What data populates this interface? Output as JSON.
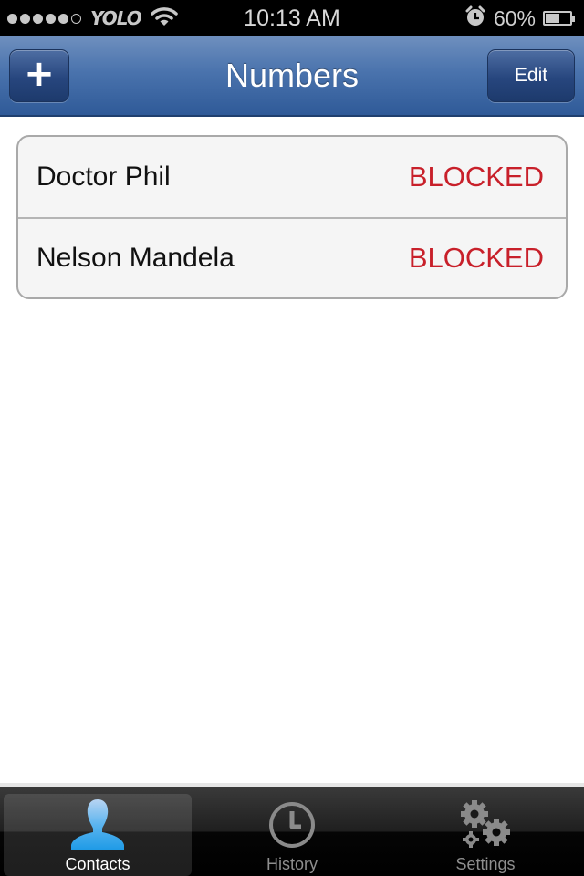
{
  "status_bar": {
    "signal_bars_filled": 5,
    "signal_bars_total": 6,
    "carrier": "YOLO",
    "time": "10:13 AM",
    "alarm_icon": "alarm-clock-icon",
    "battery_percent_label": "60%",
    "battery_level": 0.6
  },
  "navbar": {
    "title": "Numbers",
    "add_label": "+",
    "edit_label": "Edit"
  },
  "contacts": [
    {
      "name": "Doctor Phil",
      "status": "BLOCKED"
    },
    {
      "name": "Nelson Mandela",
      "status": "BLOCKED"
    }
  ],
  "colors": {
    "blocked": "#c8202a",
    "nav_blue": "#4a73ad",
    "active_tab_icon": "#3aa8ee"
  },
  "tabbar": {
    "tabs": [
      {
        "label": "Contacts",
        "icon": "person-icon",
        "active": true
      },
      {
        "label": "History",
        "icon": "clock-icon",
        "active": false
      },
      {
        "label": "Settings",
        "icon": "gears-icon",
        "active": false
      }
    ]
  }
}
